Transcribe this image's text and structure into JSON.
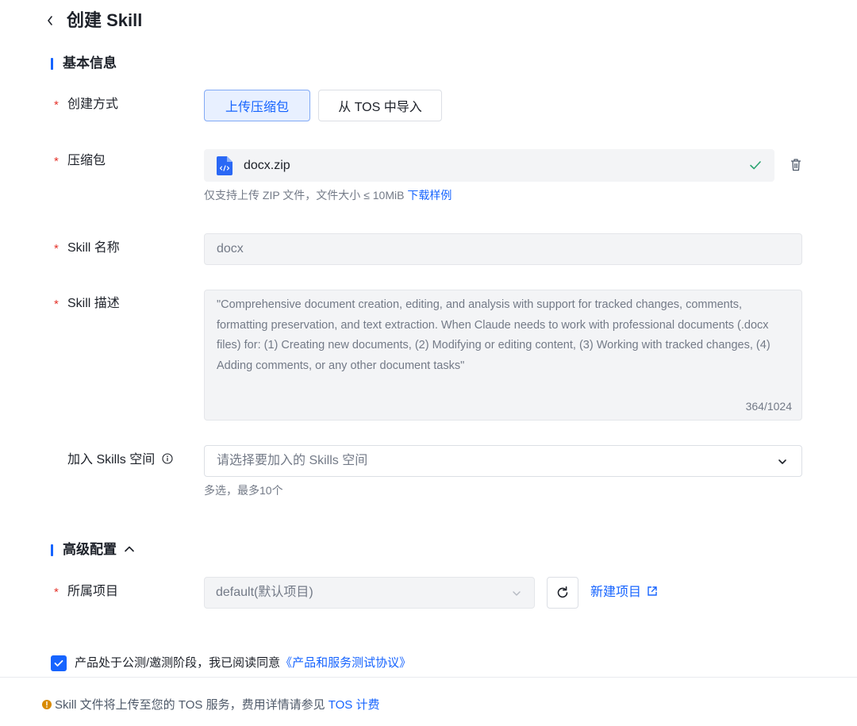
{
  "header": {
    "back_icon": "chevron-left-icon",
    "title": "创建 Skill"
  },
  "basic_section": {
    "title": "基本信息"
  },
  "create_method": {
    "label": "创建方式",
    "options": [
      "上传压缩包",
      "从 TOS 中导入"
    ],
    "selected": "上传压缩包"
  },
  "package": {
    "label": "压缩包",
    "file_name": "docx.zip",
    "file_icon": "code-file-icon",
    "status_icon": "check-icon",
    "delete_icon": "trash-icon",
    "hint": "仅支持上传 ZIP 文件，文件大小 ≤ 10MiB",
    "hint_link": "下载样例"
  },
  "skill_name": {
    "label": "Skill 名称",
    "value": "docx"
  },
  "skill_desc": {
    "label": "Skill 描述",
    "value": "\"Comprehensive document creation, editing, and analysis with support for tracked changes, comments, formatting preservation, and text extraction. When Claude needs to work with professional documents (.docx files) for: (1) Creating new documents, (2) Modifying or editing content, (3) Working with tracked changes, (4) Adding comments, or any other document tasks\"",
    "counter": "364/1024"
  },
  "space": {
    "label": "加入 Skills 空间",
    "info_icon": "info-icon",
    "placeholder": "请选择要加入的 Skills 空间",
    "hint": "多选，最多10个"
  },
  "advanced_section": {
    "title": "高级配置",
    "toggle_icon": "chevron-up-icon"
  },
  "project": {
    "label": "所属项目",
    "value": "default(默认项目)",
    "refresh_icon": "refresh-icon",
    "new_link": "新建项目",
    "external_icon": "external-link-icon"
  },
  "agreement": {
    "checked": true,
    "text": "产品处于公测/邀测阶段，我已阅读同意",
    "link": "《产品和服务测试协议》"
  },
  "footer": {
    "icon": "warning-icon",
    "text": "Skill 文件将上传至您的 TOS 服务，费用详情请参见",
    "link": "TOS 计费"
  },
  "colors": {
    "primary": "#1664ff",
    "required": "#e5342b",
    "success": "#2ba471",
    "warning": "#d98a00"
  }
}
